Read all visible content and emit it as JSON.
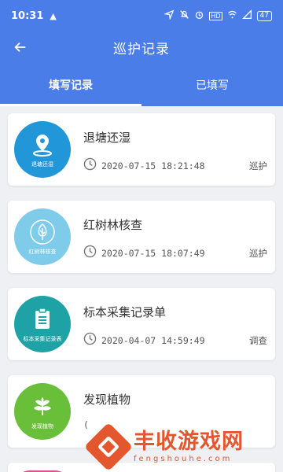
{
  "status_bar": {
    "time": "10:31",
    "battery": "47"
  },
  "app_bar": {
    "title": "巡护记录"
  },
  "tabs": [
    {
      "label": "填写记录",
      "active": true
    },
    {
      "label": "已填写",
      "active": false
    }
  ],
  "records": [
    {
      "title": "退塘还湿",
      "time": "2020-07-15 18:21:48",
      "type": "巡护",
      "thumb_caption": "退塘还湿",
      "thumb_color": "#2196d8",
      "icon": "location-pin-icon"
    },
    {
      "title": "红树林核查",
      "time": "2020-07-15 18:07:49",
      "type": "巡护",
      "thumb_caption": "红树林核查",
      "thumb_color": "#7ecbea",
      "icon": "tree-icon"
    },
    {
      "title": "标本采集记录单",
      "time": "2020-04-07 14:59:49",
      "type": "调查",
      "thumb_caption": "标本采集记录表",
      "thumb_color": "#1fa2a5",
      "icon": "clipboard-icon"
    },
    {
      "title": "发现植物",
      "time": "(",
      "type": "",
      "thumb_caption": "发现植物",
      "thumb_color": "#6abf3a",
      "icon": "plant-icon"
    }
  ],
  "watermark": {
    "title": "丰收游戏网",
    "subtitle": "fengshouhe.com"
  },
  "colors": {
    "primary": "#4b7de8",
    "watermark": "#e4572e"
  }
}
